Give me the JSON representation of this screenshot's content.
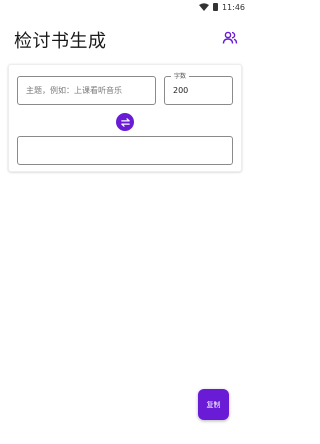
{
  "status_bar": {
    "time": "11:46",
    "icons": [
      "wifi-icon",
      "battery-icon"
    ]
  },
  "app_bar": {
    "title": "检讨书生成",
    "action_icon": "users-icon"
  },
  "form": {
    "topic_placeholder": "主题，例如：上课看听音乐",
    "topic_value": "",
    "count_label": "字数",
    "count_value": "200",
    "swap_icon": "swap-icon",
    "result_text": ""
  },
  "fab": {
    "copy_label": "复制"
  },
  "colors": {
    "accent": "#6a1bd6",
    "background": "#ffffff",
    "border": "#8a8a8a"
  }
}
